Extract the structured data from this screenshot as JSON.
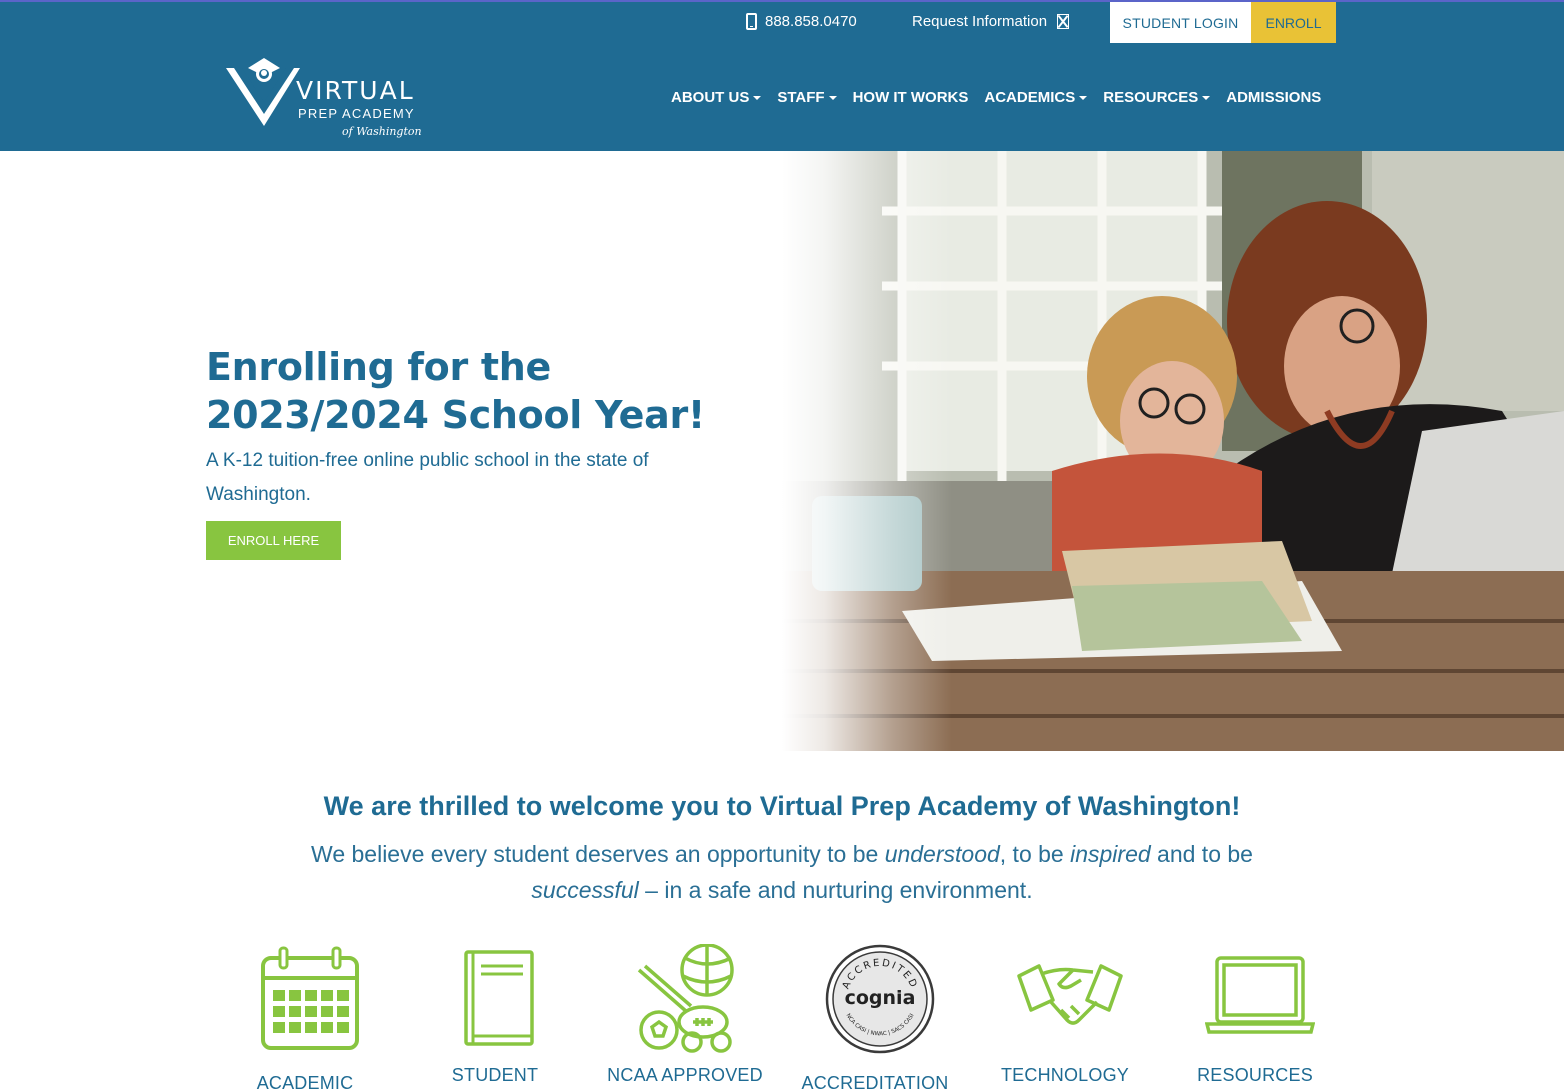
{
  "header": {
    "logo": {
      "word": "VIRTUAL",
      "sub": "PREP ACADEMY",
      "sub2": "of Washington"
    },
    "phone": "888.858.0470",
    "request_info": "Request Information",
    "student_login": "STUDENT LOGIN",
    "enroll": "ENROLL",
    "nav": [
      {
        "label": "ABOUT US",
        "dropdown": true
      },
      {
        "label": "STAFF",
        "dropdown": true
      },
      {
        "label": "HOW IT WORKS",
        "dropdown": false
      },
      {
        "label": "ACADEMICS",
        "dropdown": true
      },
      {
        "label": "RESOURCES",
        "dropdown": true
      },
      {
        "label": "ADMISSIONS",
        "dropdown": false
      }
    ]
  },
  "hero": {
    "title": "Enrolling for the 2023/2024 School Year!",
    "subtitle": "A K-12 tuition-free online public school in the state of Washington.",
    "button": "ENROLL HERE"
  },
  "welcome": {
    "title": "We are thrilled to welcome you to Virtual Prep Academy of Washington!",
    "body_1": "We believe every student deserves an opportunity to be ",
    "em_1": "understood",
    "body_2": ", to be ",
    "em_2": "inspired",
    "body_3": " and to be ",
    "em_3": "successful",
    "body_4": " – in a safe and nurturing environment."
  },
  "features": [
    {
      "label": "ACADEMIC",
      "icon": "calendar-icon"
    },
    {
      "label": "STUDENT",
      "icon": "book-icon"
    },
    {
      "label": "NCAA APPROVED",
      "icon": "sports-balls-icon"
    },
    {
      "label": "ACCREDITATION",
      "icon": "cognia-badge-icon",
      "badge_top": "ACCREDITED",
      "badge_name": "cognia",
      "badge_bottom": "NCA CASI | NWAC | SACS CASI"
    },
    {
      "label": "TECHNOLOGY",
      "icon": "handshake-icon"
    },
    {
      "label": "RESOURCES",
      "icon": "laptop-icon"
    }
  ],
  "colors": {
    "brand_blue": "#1f6b93",
    "accent_yellow": "#e9c236",
    "accent_green": "#88c540"
  }
}
